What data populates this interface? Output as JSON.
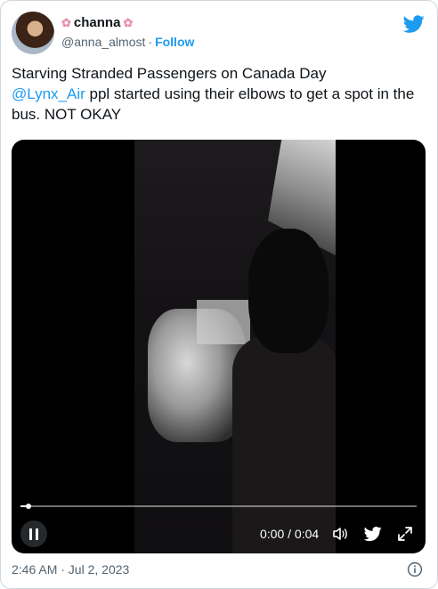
{
  "user": {
    "display_name": "channa",
    "handle": "@anna_almost",
    "separator": "·",
    "follow_label": "Follow",
    "name_emoji": "cherry-blossom-icon"
  },
  "tweet": {
    "line1": "Starving Stranded Passengers on Canada Day",
    "mention": "@Lynx_Air",
    "rest": " ppl started using their elbows to get a spot in the bus. NOT OKAY"
  },
  "video": {
    "time_display": "0:00 / 0:04",
    "progress_fraction": 0.02
  },
  "footer": {
    "timestamp": "2:46 AM · Jul 2, 2023"
  },
  "colors": {
    "accent": "#1d9bf0",
    "text": "#0f1419",
    "muted": "#536471"
  }
}
